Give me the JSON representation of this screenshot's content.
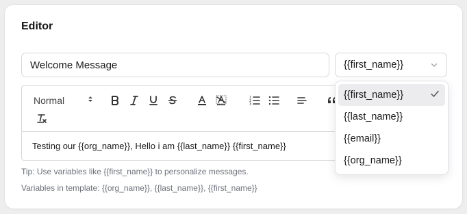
{
  "card": {
    "title": "Editor"
  },
  "title_input": {
    "value": "Welcome Message"
  },
  "variable_select": {
    "selected": "{{first_name}}",
    "options": [
      "{{first_name}}",
      "{{last_name}}",
      "{{email}}",
      "{{org_name}}"
    ]
  },
  "toolbar": {
    "header_select": "Normal",
    "buttons": [
      "bold",
      "italic",
      "underline",
      "strike",
      "color",
      "background",
      "ordered-list",
      "bullet-list",
      "align",
      "blockquote",
      "clean"
    ]
  },
  "editor": {
    "content": "Testing our {{org_name}}, Hello i am {{last_name}} {{first_name}}"
  },
  "tips": {
    "tip": "Tip: Use variables like {{first_name}} to personalize messages.",
    "variables": "Variables in template: {{org_name}}, {{last_name}}, {{first_name}}"
  },
  "colors": {
    "accent": "#1f2328",
    "muted": "#6b7078",
    "border": "#d6d8dc",
    "selected_bg": "#ececee"
  }
}
